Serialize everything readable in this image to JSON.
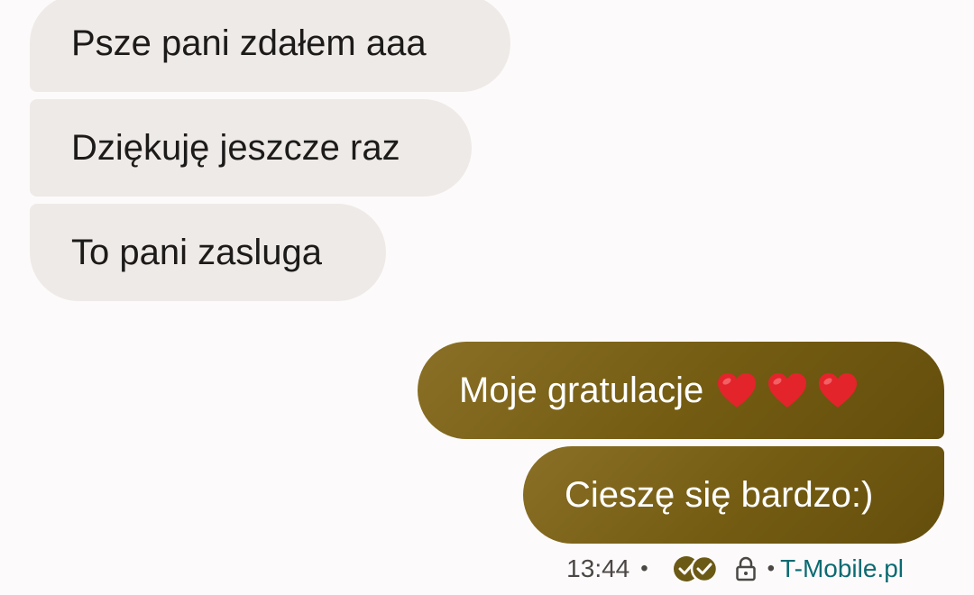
{
  "conversation": {
    "incoming": [
      {
        "text": "Psze pani zdałem aaa"
      },
      {
        "text": "Dziękuję jeszcze raz"
      },
      {
        "text": "To pani zasluga"
      }
    ],
    "outgoing": [
      {
        "text": "Moje gratulacje",
        "emoji": [
          "red-heart",
          "red-heart",
          "red-heart"
        ]
      },
      {
        "text": "Cieszę się bardzo:)"
      }
    ]
  },
  "status": {
    "time": "13:44",
    "separator": "•",
    "carrier": "T-Mobile.pl",
    "icons": [
      "double-check-icon",
      "lock-icon"
    ]
  },
  "colors": {
    "background": "#fdfafb",
    "incoming_bubble": "#eeeae7",
    "outgoing_bubble": "#735b12",
    "outgoing_text": "#ffffff",
    "carrier_text": "#0b6b72",
    "heart": "#e3242b"
  }
}
